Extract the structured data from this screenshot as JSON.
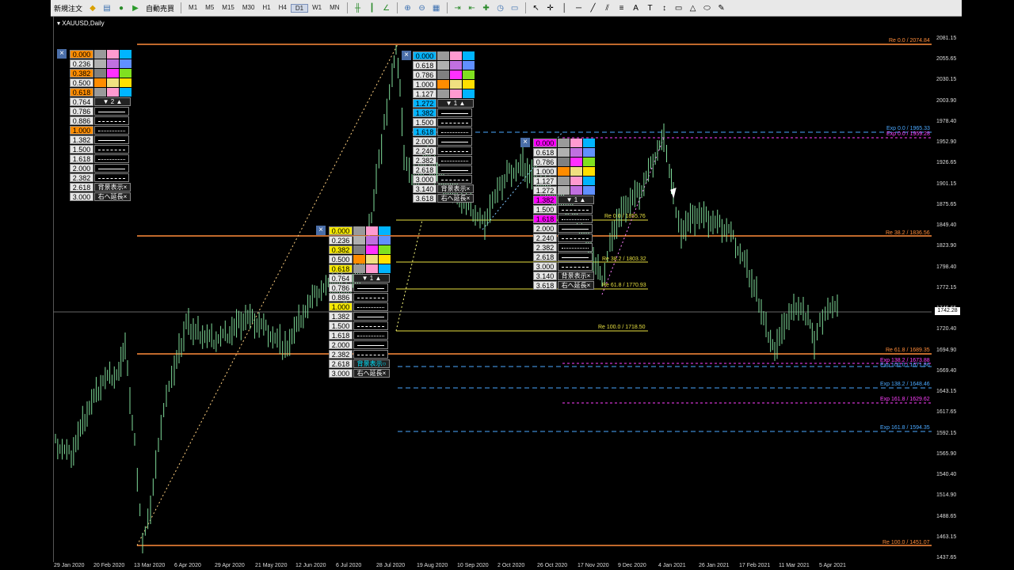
{
  "toolbar": {
    "new_order": "新規注文",
    "auto_trade": "自動売買",
    "timeframes": [
      "M1",
      "M5",
      "M15",
      "M30",
      "H1",
      "H4",
      "D1",
      "W1",
      "MN"
    ],
    "active_timeframe": "D1"
  },
  "chart": {
    "title": "XAUUSD,Daily",
    "current_price": "1742.28",
    "y_ticks": [
      "2081.15",
      "2055.65",
      "2030.15",
      "2003.90",
      "1978.40",
      "1952.90",
      "1926.65",
      "1901.15",
      "1875.65",
      "1849.40",
      "1823.90",
      "1798.40",
      "1772.15",
      "1746.65",
      "1720.40",
      "1694.90",
      "1669.40",
      "1643.15",
      "1617.65",
      "1592.15",
      "1565.90",
      "1540.40",
      "1514.90",
      "1488.65",
      "1463.15",
      "1437.65"
    ],
    "x_ticks": [
      "29 Jan 2020",
      "20 Feb 2020",
      "13 Mar 2020",
      "6 Apr 2020",
      "29 Apr 2020",
      "21 May 2020",
      "12 Jun 2020",
      "6 Jul 2020",
      "28 Jul 2020",
      "19 Aug 2020",
      "10 Sep 2020",
      "2 Oct 2020",
      "26 Oct 2020",
      "17 Nov 2020",
      "9 Dec 2020",
      "4 Jan 2021",
      "26 Jan 2021",
      "17 Feb 2021",
      "11 Mar 2021",
      "5 Apr 2021"
    ],
    "levels": [
      {
        "text": "Re 0.0 / 2074.84",
        "color": "#ff8c3a"
      },
      {
        "text": "Exp 0.0 / 1965.33",
        "color": "#4aa8ff"
      },
      {
        "text": "Exp 0.0 / 1959.28",
        "color": "#ff40ff"
      },
      {
        "text": "Re 38.2 / 1836.56",
        "color": "#ff8c3a"
      },
      {
        "text": "Re 0.0 / 1855.76",
        "color": "#e8e040"
      },
      {
        "text": "Re 38.2 / 1803.32",
        "color": "#e8e040"
      },
      {
        "text": "Re 61.8 / 1770.93",
        "color": "#e8e040"
      },
      {
        "text": "Re 100.0 / 1718.50",
        "color": "#e8e040"
      },
      {
        "text": "Re 61.8 / 1689.35",
        "color": "#ff8c3a"
      },
      {
        "text": "Exp 138.2 / 1673.88",
        "color": "#ff40ff"
      },
      {
        "text": "Exp 100.0 / 1671.86",
        "color": "#4aa8ff"
      },
      {
        "text": "Exp 138.2 / 1648.46",
        "color": "#4aa8ff"
      },
      {
        "text": "Exp 161.8 / 1629.62",
        "color": "#ff40ff"
      },
      {
        "text": "Exp 161.8 / 1594.35",
        "color": "#4aa8ff"
      },
      {
        "text": "Re 100.0 / 1451.07",
        "color": "#ff8c3a"
      }
    ]
  },
  "panels": [
    {
      "id": "p1",
      "close": "×",
      "values": [
        "0.000",
        "0.236",
        "0.382",
        "0.500",
        "0.618",
        "0.764",
        "0.786",
        "0.886",
        "1.000",
        "1.382",
        "1.500",
        "1.618",
        "2.000",
        "2.382",
        "2.618",
        "3.000"
      ],
      "highlight": {
        "0": "orange",
        "2": "orange",
        "4": "orange",
        "8": "orange"
      },
      "counter": "2",
      "bg_button": "背景表示×",
      "extend_button": "右へ延長×"
    },
    {
      "id": "p2",
      "close": "×",
      "values": [
        "0.000",
        "0.618",
        "0.786",
        "1.000",
        "1.127",
        "1.272",
        "1.382",
        "1.500",
        "1.618",
        "2.000",
        "2.240",
        "2.382",
        "2.618",
        "3.000",
        "3.140",
        "3.618"
      ],
      "highlight": {
        "0": "cyan",
        "5": "cyan",
        "6": "cyan",
        "8": "cyan"
      },
      "counter": "1",
      "bg_button": "背景表示×",
      "extend_button": "右へ延長×"
    },
    {
      "id": "p3",
      "close": "×",
      "values": [
        "0.000",
        "0.236",
        "0.382",
        "0.500",
        "0.618",
        "0.764",
        "0.786",
        "0.886",
        "1.000",
        "1.382",
        "1.500",
        "1.618",
        "2.000",
        "2.382",
        "2.618",
        "3.000"
      ],
      "highlight": {
        "0": "yellow",
        "2": "yellow",
        "4": "yellow",
        "8": "yellow"
      },
      "counter": "1",
      "bg_button": "背景表示○",
      "extend_button": "右へ延長×"
    },
    {
      "id": "p4",
      "close": "×",
      "values": [
        "0.000",
        "0.618",
        "0.786",
        "1.000",
        "1.127",
        "1.272",
        "1.382",
        "1.500",
        "1.618",
        "2.000",
        "2.240",
        "2.382",
        "2.618",
        "3.000",
        "3.140",
        "3.618"
      ],
      "highlight": {
        "0": "magenta",
        "6": "magenta",
        "8": "magenta"
      },
      "counter": "1",
      "bg_button": "背景表示×",
      "extend_button": "右へ延長×"
    }
  ]
}
